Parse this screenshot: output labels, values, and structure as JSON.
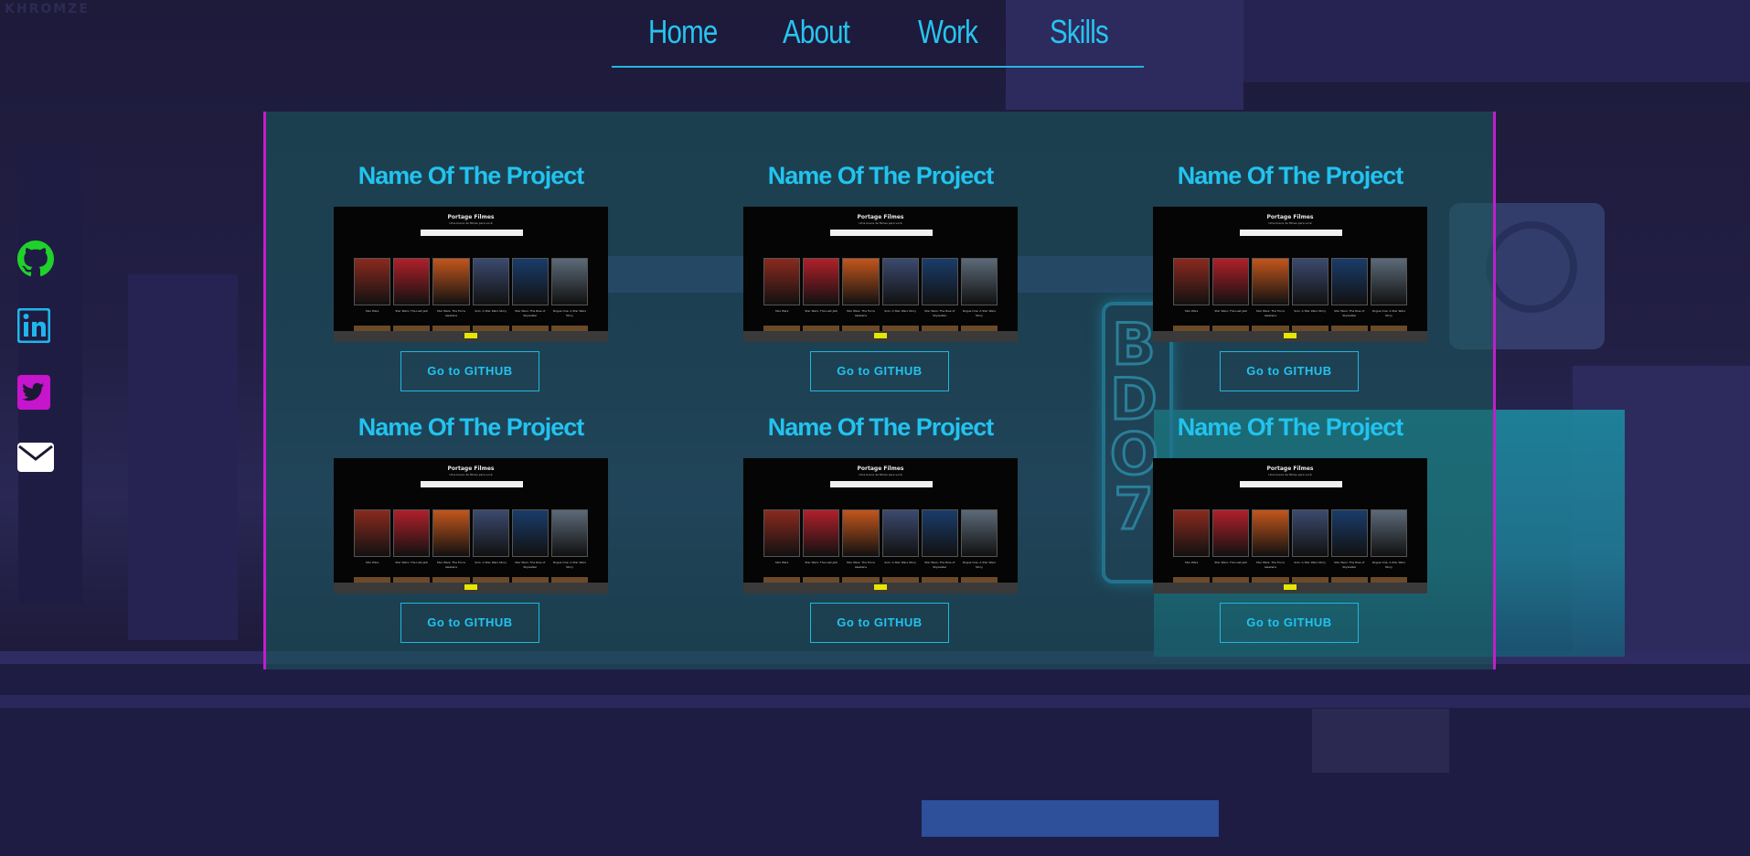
{
  "logo_text": "KHROMZE",
  "nav": {
    "items": [
      "Home",
      "About",
      "Work",
      "Skills"
    ]
  },
  "projects": [
    {
      "title": "Name Of The Project",
      "button": "Go to GITHUB"
    },
    {
      "title": "Name Of The Project",
      "button": "Go to GITHUB"
    },
    {
      "title": "Name Of The Project",
      "button": "Go to GITHUB"
    },
    {
      "title": "Name Of The Project",
      "button": "Go to GITHUB"
    },
    {
      "title": "Name Of The Project",
      "button": "Go to GITHUB"
    },
    {
      "title": "Name Of The Project",
      "button": "Go to GITHUB"
    }
  ],
  "thumbnail": {
    "site_title": "Portage Filmes",
    "subtitle": "Uma busca de filmes para você",
    "movie_titles": [
      "Star Wars",
      "Star Wars: The Last Jedi",
      "Star Wars: The Force Awakens",
      "Solo: A Star Wars Story",
      "Star Wars: The Rise of Skywalker",
      "Rogue One: A Star Wars Story"
    ]
  },
  "social": {
    "icons": [
      "github-icon",
      "linkedin-icon",
      "twitter-icon",
      "mail-icon"
    ],
    "colors": {
      "github": "#1fd12a",
      "linkedin": "#1fb6ea",
      "twitter": "#c615cc",
      "mail": "#ffffff"
    }
  },
  "colors": {
    "accent_cyan": "#22c3ef",
    "panel_border": "#c21dcc",
    "panel_bg": "#1a5c5c"
  }
}
